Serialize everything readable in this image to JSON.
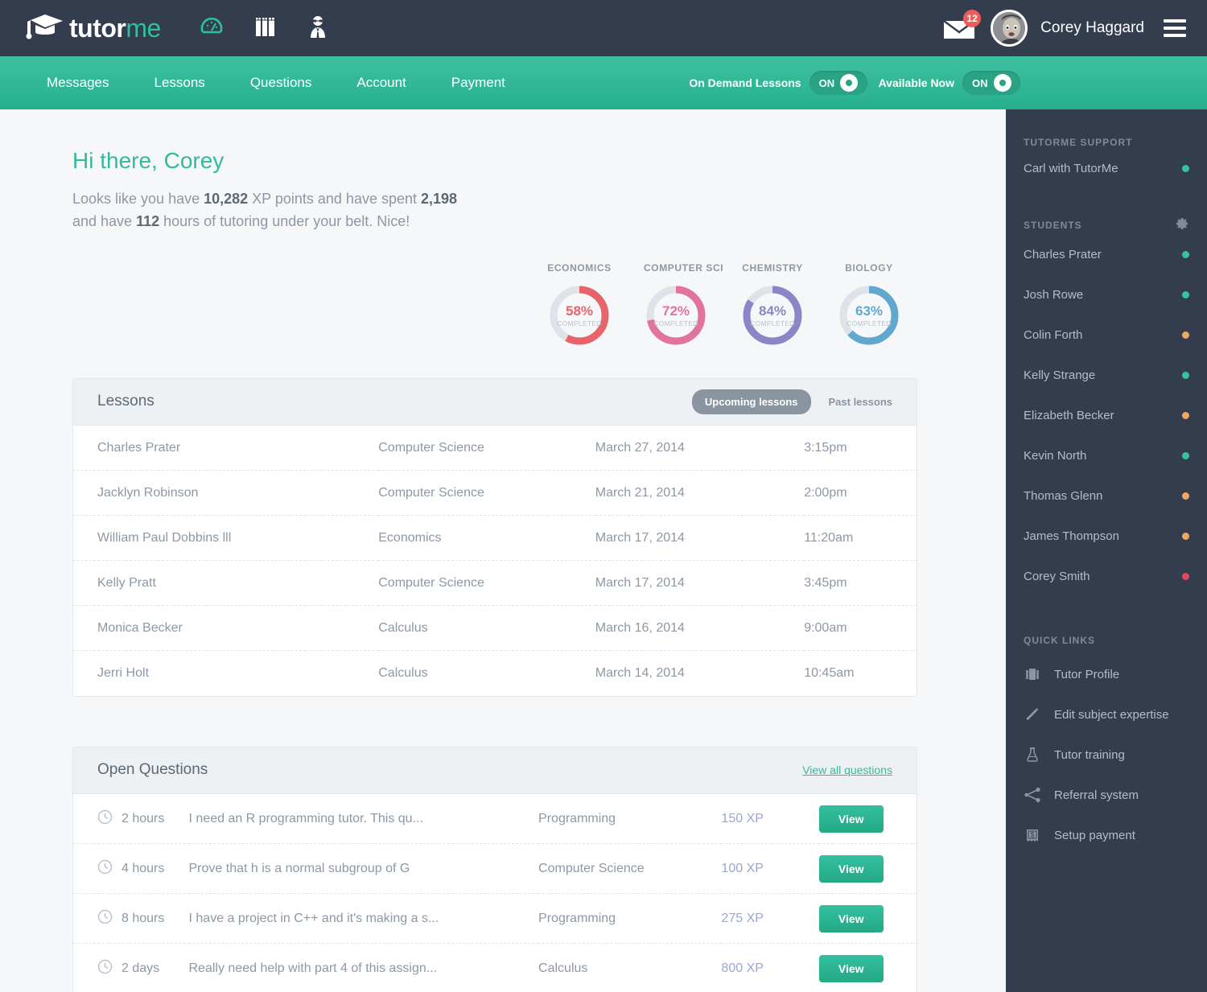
{
  "brand": {
    "name_white": "tutor",
    "name_green": "me"
  },
  "topbar": {
    "icons": [
      "dashboard-gauge-icon",
      "books-icon",
      "tutor-person-icon"
    ],
    "mail_badge": "12",
    "username": "Corey Haggard",
    "menu_icon": "hamburger-icon"
  },
  "nav": {
    "links": [
      "Messages",
      "Lessons",
      "Questions",
      "Account",
      "Payment"
    ],
    "toggles": [
      {
        "label": "On Demand Lessons",
        "state": "ON"
      },
      {
        "label": "Available Now",
        "state": "ON"
      }
    ]
  },
  "greeting": {
    "title": "Hi there, Corey",
    "line1_a": "Looks like you have ",
    "xp_points": "10,282",
    "line1_b": " XP points and have spent ",
    "xp_spent": "2,198",
    "line2_a": "and have ",
    "hours": "112",
    "line2_b": " hours of tutoring under your belt. Nice!"
  },
  "chart_data": {
    "type": "pie",
    "title": "Subject completion",
    "subtitle": "COMPLETED",
    "categories": [
      "ECONOMICS",
      "COMPUTER SCI",
      "CHEMISTRY",
      "BIOLOGY"
    ],
    "values": [
      58,
      72,
      84,
      63
    ],
    "value_labels": [
      "58%",
      "72%",
      "84%",
      "63%"
    ],
    "colors": [
      "#e8646a",
      "#e2739d",
      "#8d85c7",
      "#61a8cf"
    ],
    "track_color": "#dde3e8",
    "ylim": [
      0,
      100
    ],
    "legend": "none",
    "grid": false
  },
  "lessons_panel": {
    "title": "Lessons",
    "tab_active": "Upcoming lessons",
    "tab_inactive": "Past lessons",
    "rows": [
      {
        "student": "Charles Prater",
        "subject": "Computer Science",
        "date": "March 27, 2014",
        "time": "3:15pm"
      },
      {
        "student": "Jacklyn Robinson",
        "subject": "Computer Science",
        "date": "March 21, 2014",
        "time": "2:00pm"
      },
      {
        "student": "William Paul Dobbins lll",
        "subject": "Economics",
        "date": "March 17, 2014",
        "time": "11:20am"
      },
      {
        "student": "Kelly Pratt",
        "subject": "Computer Science",
        "date": "March 17, 2014",
        "time": "3:45pm"
      },
      {
        "student": "Monica Becker",
        "subject": "Calculus",
        "date": "March 16, 2014",
        "time": "9:00am"
      },
      {
        "student": "Jerri Holt",
        "subject": "Calculus",
        "date": "March 14, 2014",
        "time": "10:45am"
      }
    ]
  },
  "questions_panel": {
    "title": "Open Questions",
    "view_all": "View all questions",
    "button_label": "View",
    "rows": [
      {
        "age": "2 hours",
        "text": "I need an R programming tutor. This qu...",
        "subject": "Programming",
        "xp": "150 XP"
      },
      {
        "age": "4 hours",
        "text": "Prove that h is a normal subgroup of G",
        "subject": "Computer Science",
        "xp": "100 XP"
      },
      {
        "age": "8 hours",
        "text": "I have a project in C++ and it's making a s...",
        "subject": "Programming",
        "xp": "275 XP"
      },
      {
        "age": "2 days",
        "text": "Really need help with part 4 of this assign...",
        "subject": "Calculus",
        "xp": "800 XP"
      }
    ]
  },
  "sidebar": {
    "support_header": "TUTORME SUPPORT",
    "support_items": [
      {
        "name": "Carl with TutorMe",
        "status": "#35c49e"
      }
    ],
    "students_header": "STUDENTS",
    "students": [
      {
        "name": "Charles Prater",
        "status": "#35c49e"
      },
      {
        "name": "Josh Rowe",
        "status": "#35c49e"
      },
      {
        "name": "Colin Forth",
        "status": "#f0a860"
      },
      {
        "name": "Kelly Strange",
        "status": "#35c49e"
      },
      {
        "name": "Elizabeth Becker",
        "status": "#f0a860"
      },
      {
        "name": "Kevin North",
        "status": "#35c49e"
      },
      {
        "name": "Thomas Glenn",
        "status": "#f0a860"
      },
      {
        "name": "James Thompson",
        "status": "#f0a860"
      },
      {
        "name": "Corey Smith",
        "status": "#e8455f"
      }
    ],
    "quick_links_header": "QUICK LINKS",
    "quick_links": [
      {
        "label": "Tutor Profile",
        "icon": "briefcase-icon"
      },
      {
        "label": "Edit subject expertise",
        "icon": "pencil-icon"
      },
      {
        "label": "Tutor training",
        "icon": "flask-icon"
      },
      {
        "label": "Referral system",
        "icon": "share-nodes-icon"
      },
      {
        "label": "Setup payment",
        "icon": "dollar-bill-icon"
      }
    ]
  },
  "colors": {
    "brand_green": "#35b99c",
    "dark_navy": "#333d4d",
    "page_bg": "#f5f7f9"
  }
}
